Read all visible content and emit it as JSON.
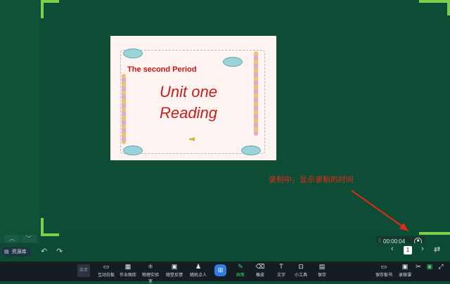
{
  "slide": {
    "subtitle": "The second Period",
    "title_line1": "Unit one",
    "title_line2": "Reading"
  },
  "annotation": {
    "text": "录制中，显示录制的时间",
    "color": "#e02a1a"
  },
  "recording": {
    "time": "00:00:04",
    "handle_icon": "drag-dots-icon",
    "stop_icon": "stop-circle-icon"
  },
  "side_nav": {
    "up_icon": "chevron-up-icon",
    "down_icon": "chevron-down-icon"
  },
  "resource": {
    "label": "资源库",
    "icon": "folder-icon"
  },
  "pager": {
    "current": "1",
    "prev_icon": "chevron-left-icon",
    "next_icon": "chevron-right-icon",
    "switch_icon": "swap-icon"
  },
  "toolbar": {
    "menu_label": "菜单",
    "items": [
      {
        "label": "互动白板",
        "icon": "whiteboard-icon"
      },
      {
        "label": "作业图库",
        "icon": "gallery-icon"
      },
      {
        "label": "物理实验室",
        "icon": "atom-icon"
      },
      {
        "label": "随堂反馈",
        "icon": "feedback-icon"
      },
      {
        "label": "随机点人",
        "icon": "person-icon"
      },
      {
        "label": "画笔",
        "icon": "pen-icon"
      },
      {
        "label": "橡皮",
        "icon": "eraser-icon"
      },
      {
        "label": "文字",
        "icon": "text-icon"
      },
      {
        "label": "小工具",
        "icon": "toolbox-icon"
      },
      {
        "label": "保存",
        "icon": "save-icon"
      },
      {
        "label": "保存板书",
        "icon": "save-board-icon"
      },
      {
        "label": "录微课",
        "icon": "record-icon"
      }
    ]
  },
  "colors": {
    "board": "#0d4d36",
    "corner": "#7bd04b",
    "toolbar": "#141d22",
    "active": "#4ad06a"
  }
}
